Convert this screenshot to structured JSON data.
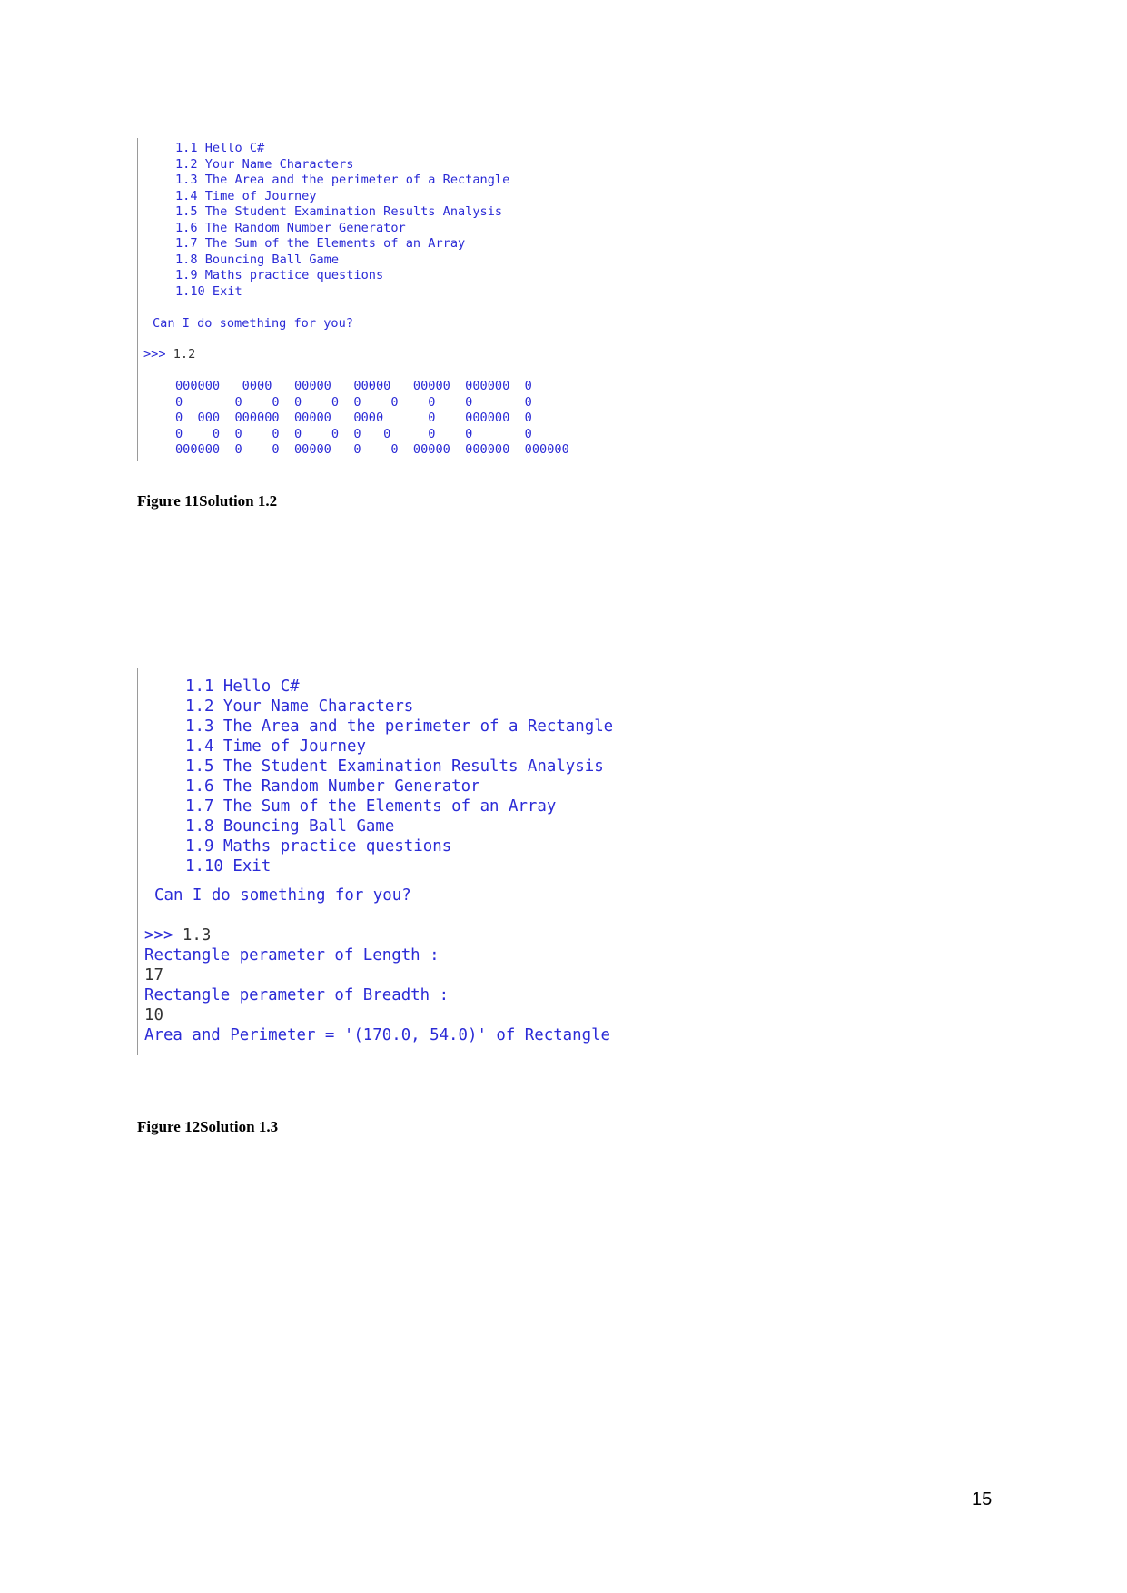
{
  "figure1": {
    "menu": [
      "1.1 Hello C#",
      "1.2 Your Name Characters",
      "1.3 The Area and the perimeter of a Rectangle",
      "1.4 Time of Journey",
      "1.5 The Student Examination Results Analysis",
      "1.6 The Random Number Generator",
      "1.7 The Sum of the Elements of an Array",
      "1.8 Bouncing Ball Game",
      "1.9 Maths practice questions",
      "1.10 Exit"
    ],
    "question": "Can I do something for you?",
    "prompt": ">>>",
    "input": "1.2",
    "art": [
      "000000   0000   00000   00000   00000  000000  0",
      "0       0    0  0    0  0    0    0    0       0",
      "0  000  000000  00000   0000      0    000000  0",
      "0    0  0    0  0    0  0   0     0    0       0",
      "000000  0    0  00000   0    0  00000  000000  000000"
    ],
    "caption": "Figure 11Solution 1.2"
  },
  "figure2": {
    "menu": [
      "1.1 Hello C#",
      "1.2 Your Name Characters",
      "1.3 The Area and the perimeter of a Rectangle",
      "1.4 Time of Journey",
      "1.5 The Student Examination Results Analysis",
      "1.6 The Random Number Generator",
      "1.7 The Sum of the Elements of an Array",
      "1.8 Bouncing Ball Game",
      "1.9 Maths practice questions",
      "1.10 Exit"
    ],
    "question": "Can I do something for you?",
    "prompt": ">>>",
    "input": "1.3",
    "length_prompt": "Rectangle perameter of Length :",
    "length_value": "17",
    "breadth_prompt": "Rectangle perameter of Breadth :",
    "breadth_value": "10",
    "result": "Area and Perimeter = '(170.0, 54.0)' of Rectangle",
    "caption": "Figure 12Solution 1.3"
  },
  "page_number": "15",
  "colors": {
    "console_text": "#2b2bd6",
    "input_text": "#333333"
  }
}
